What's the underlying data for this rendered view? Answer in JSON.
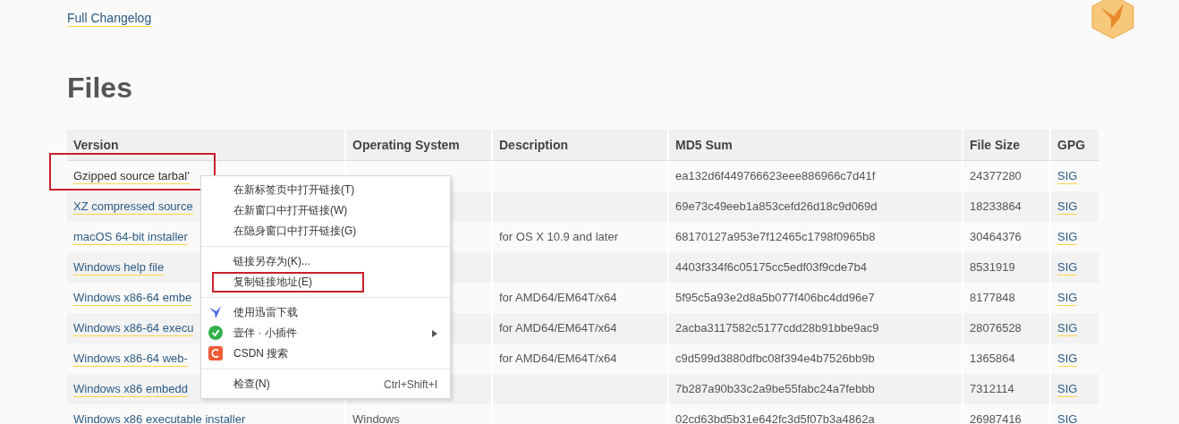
{
  "changelog_link": "Full Changelog",
  "heading": "Files",
  "table": {
    "columns": [
      "Version",
      "Operating System",
      "Description",
      "MD5 Sum",
      "File Size",
      "GPG"
    ],
    "rows": [
      {
        "version": "Gzipped source tarbal'",
        "hovered": true,
        "annotated": true,
        "os": "",
        "description": "",
        "md5": "ea132d6f449766623eee886966c7d41f",
        "size": "24377280",
        "gpg": "SIG"
      },
      {
        "version": "XZ compressed source",
        "hovered": false,
        "annotated": false,
        "os": "",
        "description": "",
        "md5": "69e73c49eeb1a853cefd26d18c9d069d",
        "size": "18233864",
        "gpg": "SIG"
      },
      {
        "version": "macOS 64-bit installer",
        "hovered": false,
        "annotated": false,
        "os": "",
        "description": "for OS X 10.9 and later",
        "md5": "68170127a953e7f12465c1798f0965b8",
        "size": "30464376",
        "gpg": "SIG"
      },
      {
        "version": "Windows help file",
        "hovered": false,
        "annotated": false,
        "os": "",
        "description": "",
        "md5": "4403f334f6c05175cc5edf03f9cde7b4",
        "size": "8531919",
        "gpg": "SIG"
      },
      {
        "version": "Windows x86-64 embe",
        "hovered": false,
        "annotated": false,
        "os": "",
        "description": "for AMD64/EM64T/x64",
        "md5": "5f95c5a93e2d8a5b077f406bc4dd96e7",
        "size": "8177848",
        "gpg": "SIG"
      },
      {
        "version": "Windows x86-64 execu",
        "hovered": false,
        "annotated": false,
        "os": "",
        "description": "for AMD64/EM64T/x64",
        "md5": "2acba3117582c5177cdd28b91bbe9ac9",
        "size": "28076528",
        "gpg": "SIG"
      },
      {
        "version": "Windows x86-64 web-",
        "hovered": false,
        "annotated": false,
        "os": "",
        "description": "for AMD64/EM64T/x64",
        "md5": "c9d599d3880dfbc08f394e4b7526bb9b",
        "size": "1365864",
        "gpg": "SIG"
      },
      {
        "version": "Windows x86 embedd",
        "hovered": false,
        "annotated": false,
        "os": "",
        "description": "",
        "md5": "7b287a90b33c2a9be55fabc24a7febbb",
        "size": "7312114",
        "gpg": "SIG"
      },
      {
        "version": "Windows x86 executable installer",
        "hovered": false,
        "annotated": false,
        "os": "Windows",
        "description": "",
        "md5": "02cd63bd5b31e642fc3d5f07b3a4862a",
        "size": "26987416",
        "gpg": "SIG"
      }
    ]
  },
  "context_menu": {
    "groups": [
      [
        {
          "label": "在新标签页中打开链接(T)",
          "kind": "plain",
          "annotated": false,
          "submenu": false
        },
        {
          "label": "在新窗口中打开链接(W)",
          "kind": "plain",
          "annotated": false,
          "submenu": false
        },
        {
          "label": "在隐身窗口中打开链接(G)",
          "kind": "plain",
          "annotated": false,
          "submenu": false
        }
      ],
      [
        {
          "label": "链接另存为(K)...",
          "kind": "plain",
          "annotated": false,
          "submenu": false
        },
        {
          "label": "复制链接地址(E)",
          "kind": "plain",
          "annotated": true,
          "submenu": false
        }
      ],
      [
        {
          "label": "使用迅雷下载",
          "kind": "downloader",
          "annotated": false,
          "submenu": false
        },
        {
          "label": "壹伴 · 小插件",
          "kind": "plugin",
          "annotated": false,
          "submenu": true
        },
        {
          "label": "CSDN 搜索",
          "kind": "search",
          "annotated": false,
          "submenu": false
        }
      ],
      [
        {
          "label": "检查(N)",
          "kind": "plain",
          "shortcut": "Ctrl+Shift+I",
          "annotated": false,
          "submenu": false
        }
      ]
    ]
  }
}
